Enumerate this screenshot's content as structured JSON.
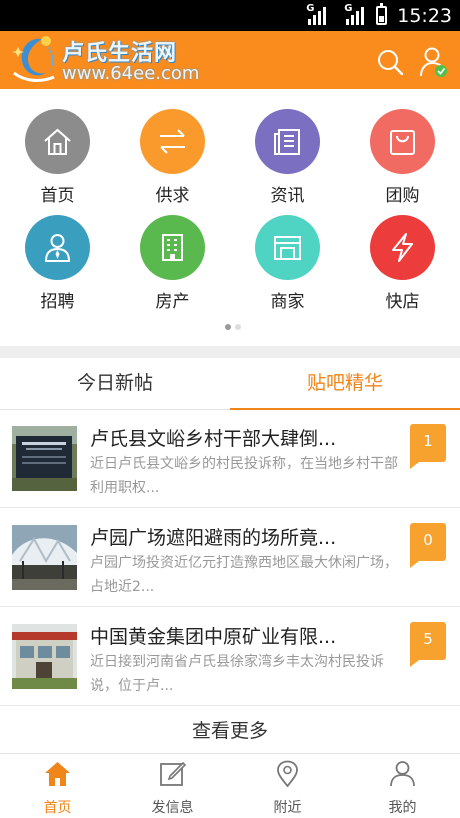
{
  "status_bar": {
    "time": "15:23",
    "network_1": "G",
    "network_2": "G"
  },
  "header": {
    "logo_title": "卢氏生活网",
    "logo_url": "www.64ee.com",
    "search_icon": "search-icon",
    "user_icon": "user-verified-icon",
    "color": "#fa8c1d"
  },
  "grid": {
    "items": [
      {
        "label": "首页",
        "icon": "home-icon",
        "color": "#8c8c8c"
      },
      {
        "label": "供求",
        "icon": "exchange-icon",
        "color": "#fa9a2d"
      },
      {
        "label": "资讯",
        "icon": "news-icon",
        "color": "#7b6fc1"
      },
      {
        "label": "团购",
        "icon": "shopping-bag-icon",
        "color": "#f26b63"
      },
      {
        "label": "招聘",
        "icon": "recruit-icon",
        "color": "#3a9fbe"
      },
      {
        "label": "房产",
        "icon": "building-icon",
        "color": "#5ab94e"
      },
      {
        "label": "商家",
        "icon": "storefront-icon",
        "color": "#4fd3c3"
      },
      {
        "label": "快店",
        "icon": "lightning-icon",
        "color": "#ec3c3c"
      }
    ]
  },
  "tabs": [
    {
      "label": "今日新帖",
      "active": false
    },
    {
      "label": "贴吧精华",
      "active": true
    }
  ],
  "posts": [
    {
      "title": "卢氏县文峪乡村干部大肆倒...",
      "desc": "近日卢氏县文峪乡的村民投诉称，在当地乡村干部利用职权...",
      "count": "1"
    },
    {
      "title": "卢园广场遮阳避雨的场所竟...",
      "desc": "卢园广场投资近亿元打造豫西地区最大休闲广场，占地近2...",
      "count": "0"
    },
    {
      "title": "中国黄金集团中原矿业有限...",
      "desc": "近日接到河南省卢氏县徐家湾乡丰太沟村民投诉说，位于卢...",
      "count": "5"
    }
  ],
  "more_label": "查看更多",
  "bottom_nav": [
    {
      "label": "首页",
      "icon": "home-icon",
      "active": true
    },
    {
      "label": "发信息",
      "icon": "compose-icon",
      "active": false
    },
    {
      "label": "附近",
      "icon": "location-pin-icon",
      "active": false
    },
    {
      "label": "我的",
      "icon": "user-icon",
      "active": false
    }
  ],
  "accent_color": "#f08519"
}
